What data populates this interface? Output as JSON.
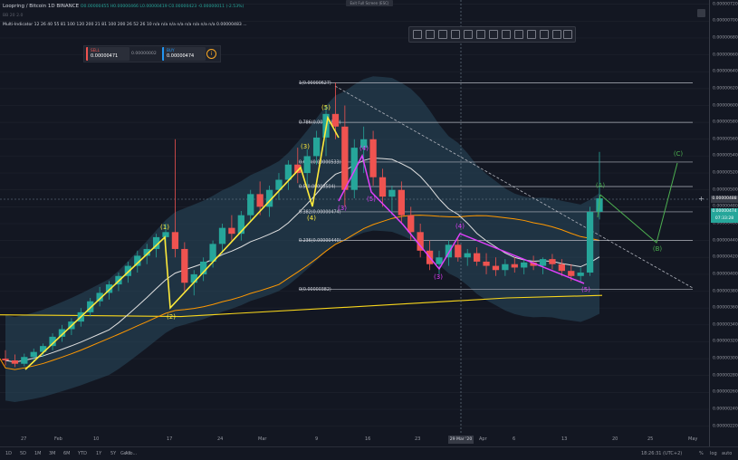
{
  "legend": {
    "title": "Loopring / Bitcoin   1D   BINANCE",
    "ohlc": "O0.00000455  H0.00000466  L0.00000419  C0.00000423  -0.00000011 (-2.53%)",
    "indicator_line": "BB 20 2.0",
    "multi_indicator": "Multi-Indicator  12 26 40 55 81 100 120 200 21 81 100 200 26 52 26 10   n/a  n/a  n/a  n/a  n/a  n/a  n/a  n/a  0.00000483 ..."
  },
  "trade_panel": {
    "sell_label": "SELL",
    "sell_value": "0.00000471",
    "spread": "0.00000002",
    "buy_label": "BUY",
    "buy_value": "0.00000474"
  },
  "fullscreen_hint": "Exit Full Screen (ESC)",
  "price_axis": {
    "ticks": [
      "0.00000720",
      "0.00000700",
      "0.00000680",
      "0.00000660",
      "0.00000640",
      "0.00000620",
      "0.00000600",
      "0.00000580",
      "0.00000560",
      "0.00000540",
      "0.00000520",
      "0.00000500",
      "0.00000480",
      "0.00000460",
      "0.00000440",
      "0.00000420",
      "0.00000400",
      "0.00000380",
      "0.00000360",
      "0.00000340",
      "0.00000320",
      "0.00000300",
      "0.00000280",
      "0.00000260",
      "0.00000240",
      "0.00000220"
    ],
    "last_price_tag": "0.00000474",
    "countdown_tag": "07:33:28",
    "crosshair_price": "0.00000488"
  },
  "time_axis": {
    "ticks": [
      "27",
      "Feb",
      "10",
      "17",
      "24",
      "Mar",
      "9",
      "16",
      "23",
      "Apr",
      "6",
      "13",
      "20",
      "25",
      "May"
    ],
    "crosshair_date": "29 Mar '20"
  },
  "fib_levels": [
    "1(0.00000627)",
    "0.786(0.00000580)",
    "0.618(0.00000533)",
    "0.5(0.00000504)",
    "0.382(0.00000474)",
    "0.236(0.00000440)",
    "0(0.00000382)"
  ],
  "wave_labels": {
    "impulse": [
      "(1)",
      "(2)",
      "(3)",
      "(4)",
      "(5)"
    ],
    "sub": [
      "(3)",
      "(4)",
      "(5)"
    ],
    "correction": [
      "(3)",
      "(4)",
      "(5)"
    ],
    "abc": [
      "(A)",
      "(B)",
      "(C)"
    ]
  },
  "bottom_bar": {
    "timeframes": [
      "1D",
      "5D",
      "1M",
      "3M",
      "6M",
      "YTD",
      "1Y",
      "5Y",
      "All"
    ],
    "goto": "Go to...",
    "clock": "18:26:31 (UTC+2)",
    "pct": "%",
    "log": "log",
    "auto": "auto"
  },
  "colors": {
    "up": "#26a69a",
    "down": "#ef5350",
    "background": "#131722",
    "wave_yellow": "#ffeb3b",
    "wave_magenta": "#e040fb",
    "projection_green": "#4caf50",
    "ma_orange": "#ff9800",
    "ma_white": "#e0e0e0",
    "band_fill": "#2a4a5e"
  },
  "chart_data": {
    "type": "candlestick",
    "symbol": "LRC/BTC",
    "interval": "1D",
    "candles_approx": [
      [
        3e-06,
        3.1e-06,
        2.92e-06,
        2.98e-06
      ],
      [
        2.98e-06,
        3.05e-06,
        2.9e-06,
        2.94e-06
      ],
      [
        2.94e-06,
        3.06e-06,
        2.91e-06,
        3.02e-06
      ],
      [
        3.02e-06,
        3.12e-06,
        2.96e-06,
        3.08e-06
      ],
      [
        3.08e-06,
        3.18e-06,
        3.02e-06,
        3.15e-06
      ],
      [
        3.15e-06,
        3.3e-06,
        3.1e-06,
        3.26e-06
      ],
      [
        3.26e-06,
        3.4e-06,
        3.2e-06,
        3.35e-06
      ],
      [
        3.35e-06,
        3.48e-06,
        3.28e-06,
        3.44e-06
      ],
      [
        3.44e-06,
        3.6e-06,
        3.38e-06,
        3.55e-06
      ],
      [
        3.55e-06,
        3.72e-06,
        3.5e-06,
        3.68e-06
      ],
      [
        3.68e-06,
        3.85e-06,
        3.62e-06,
        3.78e-06
      ],
      [
        3.78e-06,
        3.92e-06,
        3.7e-06,
        3.88e-06
      ],
      [
        3.88e-06,
        4.02e-06,
        3.8e-06,
        3.98e-06
      ],
      [
        3.98e-06,
        4.15e-06,
        3.9e-06,
        4.1e-06
      ],
      [
        4.1e-06,
        4.28e-06,
        4.02e-06,
        4.22e-06
      ],
      [
        4.22e-06,
        4.36e-06,
        4.12e-06,
        4.3e-06
      ],
      [
        4.3e-06,
        4.48e-06,
        4.2e-06,
        4.44e-06
      ],
      [
        4.44e-06,
        4.6e-06,
        4.32e-06,
        4.5e-06
      ],
      [
        4.5e-06,
        5.6e-06,
        4.2e-06,
        4.3e-06
      ],
      [
        4.3e-06,
        4.38e-06,
        3.8e-06,
        3.9e-06
      ],
      [
        3.9e-06,
        4.05e-06,
        3.75e-06,
        4e-06
      ],
      [
        4e-06,
        4.2e-06,
        3.92e-06,
        4.15e-06
      ],
      [
        4.15e-06,
        4.4e-06,
        4.08e-06,
        4.36e-06
      ],
      [
        4.36e-06,
        4.6e-06,
        4.25e-06,
        4.55e-06
      ],
      [
        4.55e-06,
        4.7e-06,
        4.4e-06,
        4.48e-06
      ],
      [
        4.48e-06,
        4.75e-06,
        4.4e-06,
        4.7e-06
      ],
      [
        4.7e-06,
        5e-06,
        4.62e-06,
        4.95e-06
      ],
      [
        4.95e-06,
        5.1e-06,
        4.7e-06,
        4.8e-06
      ],
      [
        4.8e-06,
        5.05e-06,
        4.68e-06,
        5e-06
      ],
      [
        5e-06,
        5.2e-06,
        4.88e-06,
        5.12e-06
      ],
      [
        5.12e-06,
        5.35e-06,
        5e-06,
        5.3e-06
      ],
      [
        5.3e-06,
        5.5e-06,
        5.08e-06,
        5.2e-06
      ],
      [
        5.2e-06,
        5.48e-06,
        5.05e-06,
        5.4e-06
      ],
      [
        5.4e-06,
        5.7e-06,
        5.3e-06,
        5.62e-06
      ],
      [
        5.62e-06,
        6e-06,
        5.4e-06,
        5.9e-06
      ],
      [
        5.9e-06,
        6.27e-06,
        5.6e-06,
        5.75e-06
      ],
      [
        5.75e-06,
        6e-06,
        4.8e-06,
        5e-06
      ],
      [
        5e-06,
        5.6e-06,
        4.9e-06,
        5.5e-06
      ],
      [
        5.5e-06,
        5.75e-06,
        5.2e-06,
        5.6e-06
      ],
      [
        5.6e-06,
        5.7e-06,
        5.05e-06,
        5.15e-06
      ],
      [
        5.15e-06,
        5.25e-06,
        4.8e-06,
        4.92e-06
      ],
      [
        4.92e-06,
        5.05e-06,
        4.7e-06,
        5e-06
      ],
      [
        5e-06,
        5.1e-06,
        4.6e-06,
        4.7e-06
      ],
      [
        4.7e-06,
        4.8e-06,
        4.4e-06,
        4.5e-06
      ],
      [
        4.5e-06,
        4.6e-06,
        4.2e-06,
        4.28e-06
      ],
      [
        4.28e-06,
        4.4e-06,
        4.05e-06,
        4.12e-06
      ],
      [
        4.12e-06,
        4.28e-06,
        4e-06,
        4.2e-06
      ],
      [
        4.2e-06,
        4.4e-06,
        4.1e-06,
        4.35e-06
      ],
      [
        4.35e-06,
        4.42e-06,
        4.15e-06,
        4.2e-06
      ],
      [
        4.2e-06,
        4.3e-06,
        4.1e-06,
        4.25e-06
      ],
      [
        4.25e-06,
        4.32e-06,
        4.1e-06,
        4.15e-06
      ],
      [
        4.15e-06,
        4.25e-06,
        4e-06,
        4.1e-06
      ],
      [
        4.1e-06,
        4.2e-06,
        3.98e-06,
        4.05e-06
      ],
      [
        4.05e-06,
        4.18e-06,
        3.98e-06,
        4.12e-06
      ],
      [
        4.12e-06,
        4.2e-06,
        4.02e-06,
        4.08e-06
      ],
      [
        4.08e-06,
        4.18e-06,
        4e-06,
        4.14e-06
      ],
      [
        4.14e-06,
        4.22e-06,
        4.05e-06,
        4.1e-06
      ],
      [
        4.1e-06,
        4.2e-06,
        4e-06,
        4.18e-06
      ],
      [
        4.18e-06,
        4.24e-06,
        4.06e-06,
        4.12e-06
      ],
      [
        4.12e-06,
        4.18e-06,
        3.98e-06,
        4.04e-06
      ],
      [
        4.04e-06,
        4.12e-06,
        3.92e-06,
        3.98e-06
      ],
      [
        3.98e-06,
        4.08e-06,
        3.9e-06,
        4.02e-06
      ],
      [
        4.02e-06,
        4.8e-06,
        3.98e-06,
        4.74e-06
      ],
      [
        4.74e-06,
        5.45e-06,
        4.65e-06,
        4.9e-06
      ]
    ],
    "ylim": [
      2.1e-06,
      7.25e-06
    ],
    "grid": true
  }
}
